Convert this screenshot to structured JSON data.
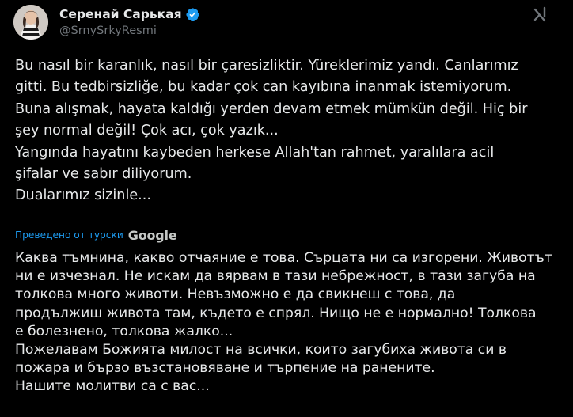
{
  "author": {
    "display_name": "Серенай Сарькая",
    "handle": "@SrnySrkyResmi",
    "verified": true
  },
  "tweet": {
    "lines": [
      "Bu nasıl bir karanlık, nasıl bir çaresizliktir. Yüreklerimiz yandı. Canlarımız",
      "gitti. Bu tedbirsizliğe, bu kadar çok can kayıbına inanmak istemiyorum.",
      "Buna alışmak, hayata kaldığı yerden devam etmek mümkün değil. Hiç bir",
      "şey normal değil! Çok acı, çok yazık...",
      "Yangında hayatını kaybeden herkese Allah'tan rahmet, yaralılara acil",
      "şifalar ve sabır diliyorum.",
      "Dualarımız sizinle..."
    ]
  },
  "translation": {
    "label": "Преведено от турски",
    "provider": "Google",
    "lines": [
      "Каква тъмнина, какво отчаяние е това. Сърцата ни са изгорени. Животът",
      "ни е изчезнал. Не искам да вярвам в тази небрежност, в тази загуба на",
      "толкова много животи. Невъзможно е да свикнеш с това, да",
      "продължиш живота там, където е спрял. Нищо не е нормално! Толкова",
      "е болезнено, толкова жалко...",
      "Пожелавам Божията милост на всички, които загубиха живота си в",
      "пожара и бързо възстановяване и търпение на ранените.",
      "Нашите молитви са с вас..."
    ]
  },
  "icons": {
    "avatar": "profile-photo",
    "verified": "verified-badge-icon",
    "grok": "grok-icon"
  },
  "colors": {
    "background": "#000000",
    "text": "#e7e9ea",
    "secondary": "#71767b",
    "accent": "#1d9bf0"
  }
}
